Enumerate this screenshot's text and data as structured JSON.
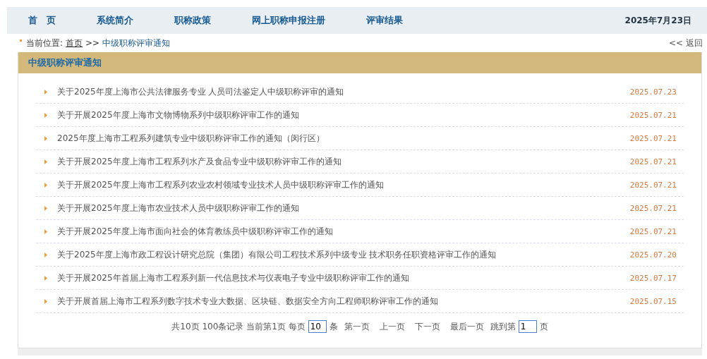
{
  "nav": {
    "items": [
      {
        "label": "首　页",
        "selected": false
      },
      {
        "label": "系统简介",
        "selected": false
      },
      {
        "label": "职称政策",
        "selected": false
      },
      {
        "label": "网上职称申报注册",
        "selected": false
      },
      {
        "label": "评审结果",
        "selected": false
      }
    ],
    "date": "2025年7月23日"
  },
  "breadcrumb": {
    "prefix": "当前位置:",
    "home": "首页",
    "separator": ">>",
    "current": "中级职称评审通知",
    "back": "<< 返回"
  },
  "panel": {
    "title": "中级职称评审通知",
    "items": [
      {
        "title": "关于2025年度上海市公共法律服务专业 人员司法鉴定人中级职称评审的通知",
        "date": "2025.07.23"
      },
      {
        "title": "关于开展2025年度上海市文物博物系列中级职称评审工作的通知",
        "date": "2025.07.21"
      },
      {
        "title": "2025年度上海市工程系列建筑专业中级职称评审工作的通知（闵行区）",
        "date": "2025.07.21"
      },
      {
        "title": "关于开展2025年度上海市工程系列水产及食品专业中级职称评审工作的通知",
        "date": "2025.07.21"
      },
      {
        "title": "关于开展2025年度上海市工程系列农业农村领域专业技术人员中级职称评审工作的通知",
        "date": "2025.07.21"
      },
      {
        "title": "关于开展2025年度上海市农业技术人员中级职称评审工作的通知",
        "date": "2025.07.21"
      },
      {
        "title": "关于开展2025年度上海市面向社会的体育教练员中级职称评审工作的通知",
        "date": "2025.07.21"
      },
      {
        "title": "关于2025年度上海市政工程设计研究总院（集团）有限公司工程技术系列中级专业 技术职务任职资格评审工作的通知",
        "date": "2025.07.20"
      },
      {
        "title": "关于开展2025年首届上海市工程系列新一代信息技术与仪表电子专业中级职称评审工作的通知",
        "date": "2025.07.17"
      },
      {
        "title": "关于开展首届上海市工程系列数字技术专业大数据、区块链、数据安全方向工程师职称评审工作的通知",
        "date": "2025.07.15"
      }
    ]
  },
  "pagination": {
    "summary": "共10页 100条记录 当前第1页 每页",
    "page_size": "10",
    "unit": "条",
    "links": [
      "第一页",
      "上一页",
      "下一页",
      "最后一页"
    ],
    "jump_label": "跳到第",
    "jump_value": "1",
    "jump_unit": "页"
  }
}
